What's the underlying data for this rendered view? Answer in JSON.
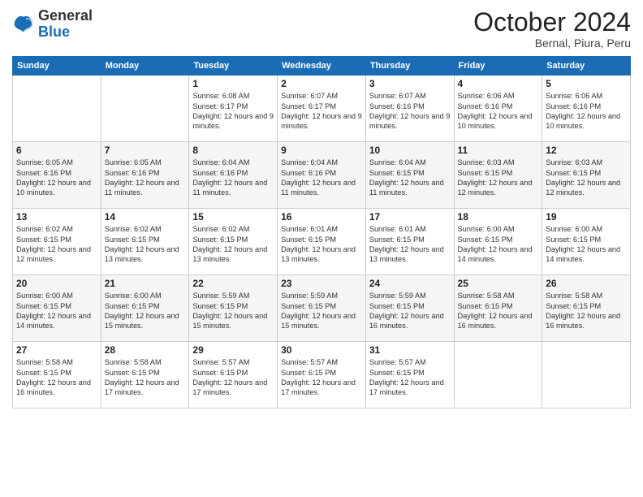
{
  "header": {
    "logo_general": "General",
    "logo_blue": "Blue",
    "month_title": "October 2024",
    "subtitle": "Bernal, Piura, Peru"
  },
  "days_of_week": [
    "Sunday",
    "Monday",
    "Tuesday",
    "Wednesday",
    "Thursday",
    "Friday",
    "Saturday"
  ],
  "weeks": [
    [
      {
        "day": "",
        "info": ""
      },
      {
        "day": "",
        "info": ""
      },
      {
        "day": "1",
        "info": "Sunrise: 6:08 AM\nSunset: 6:17 PM\nDaylight: 12 hours and 9 minutes."
      },
      {
        "day": "2",
        "info": "Sunrise: 6:07 AM\nSunset: 6:17 PM\nDaylight: 12 hours and 9 minutes."
      },
      {
        "day": "3",
        "info": "Sunrise: 6:07 AM\nSunset: 6:16 PM\nDaylight: 12 hours and 9 minutes."
      },
      {
        "day": "4",
        "info": "Sunrise: 6:06 AM\nSunset: 6:16 PM\nDaylight: 12 hours and 10 minutes."
      },
      {
        "day": "5",
        "info": "Sunrise: 6:06 AM\nSunset: 6:16 PM\nDaylight: 12 hours and 10 minutes."
      }
    ],
    [
      {
        "day": "6",
        "info": "Sunrise: 6:05 AM\nSunset: 6:16 PM\nDaylight: 12 hours and 10 minutes."
      },
      {
        "day": "7",
        "info": "Sunrise: 6:05 AM\nSunset: 6:16 PM\nDaylight: 12 hours and 11 minutes."
      },
      {
        "day": "8",
        "info": "Sunrise: 6:04 AM\nSunset: 6:16 PM\nDaylight: 12 hours and 11 minutes."
      },
      {
        "day": "9",
        "info": "Sunrise: 6:04 AM\nSunset: 6:16 PM\nDaylight: 12 hours and 11 minutes."
      },
      {
        "day": "10",
        "info": "Sunrise: 6:04 AM\nSunset: 6:15 PM\nDaylight: 12 hours and 11 minutes."
      },
      {
        "day": "11",
        "info": "Sunrise: 6:03 AM\nSunset: 6:15 PM\nDaylight: 12 hours and 12 minutes."
      },
      {
        "day": "12",
        "info": "Sunrise: 6:03 AM\nSunset: 6:15 PM\nDaylight: 12 hours and 12 minutes."
      }
    ],
    [
      {
        "day": "13",
        "info": "Sunrise: 6:02 AM\nSunset: 6:15 PM\nDaylight: 12 hours and 12 minutes."
      },
      {
        "day": "14",
        "info": "Sunrise: 6:02 AM\nSunset: 6:15 PM\nDaylight: 12 hours and 13 minutes."
      },
      {
        "day": "15",
        "info": "Sunrise: 6:02 AM\nSunset: 6:15 PM\nDaylight: 12 hours and 13 minutes."
      },
      {
        "day": "16",
        "info": "Sunrise: 6:01 AM\nSunset: 6:15 PM\nDaylight: 12 hours and 13 minutes."
      },
      {
        "day": "17",
        "info": "Sunrise: 6:01 AM\nSunset: 6:15 PM\nDaylight: 12 hours and 13 minutes."
      },
      {
        "day": "18",
        "info": "Sunrise: 6:00 AM\nSunset: 6:15 PM\nDaylight: 12 hours and 14 minutes."
      },
      {
        "day": "19",
        "info": "Sunrise: 6:00 AM\nSunset: 6:15 PM\nDaylight: 12 hours and 14 minutes."
      }
    ],
    [
      {
        "day": "20",
        "info": "Sunrise: 6:00 AM\nSunset: 6:15 PM\nDaylight: 12 hours and 14 minutes."
      },
      {
        "day": "21",
        "info": "Sunrise: 6:00 AM\nSunset: 6:15 PM\nDaylight: 12 hours and 15 minutes."
      },
      {
        "day": "22",
        "info": "Sunrise: 5:59 AM\nSunset: 6:15 PM\nDaylight: 12 hours and 15 minutes."
      },
      {
        "day": "23",
        "info": "Sunrise: 5:59 AM\nSunset: 6:15 PM\nDaylight: 12 hours and 15 minutes."
      },
      {
        "day": "24",
        "info": "Sunrise: 5:59 AM\nSunset: 6:15 PM\nDaylight: 12 hours and 16 minutes."
      },
      {
        "day": "25",
        "info": "Sunrise: 5:58 AM\nSunset: 6:15 PM\nDaylight: 12 hours and 16 minutes."
      },
      {
        "day": "26",
        "info": "Sunrise: 5:58 AM\nSunset: 6:15 PM\nDaylight: 12 hours and 16 minutes."
      }
    ],
    [
      {
        "day": "27",
        "info": "Sunrise: 5:58 AM\nSunset: 6:15 PM\nDaylight: 12 hours and 16 minutes."
      },
      {
        "day": "28",
        "info": "Sunrise: 5:58 AM\nSunset: 6:15 PM\nDaylight: 12 hours and 17 minutes."
      },
      {
        "day": "29",
        "info": "Sunrise: 5:57 AM\nSunset: 6:15 PM\nDaylight: 12 hours and 17 minutes."
      },
      {
        "day": "30",
        "info": "Sunrise: 5:57 AM\nSunset: 6:15 PM\nDaylight: 12 hours and 17 minutes."
      },
      {
        "day": "31",
        "info": "Sunrise: 5:57 AM\nSunset: 6:15 PM\nDaylight: 12 hours and 17 minutes."
      },
      {
        "day": "",
        "info": ""
      },
      {
        "day": "",
        "info": ""
      }
    ]
  ]
}
